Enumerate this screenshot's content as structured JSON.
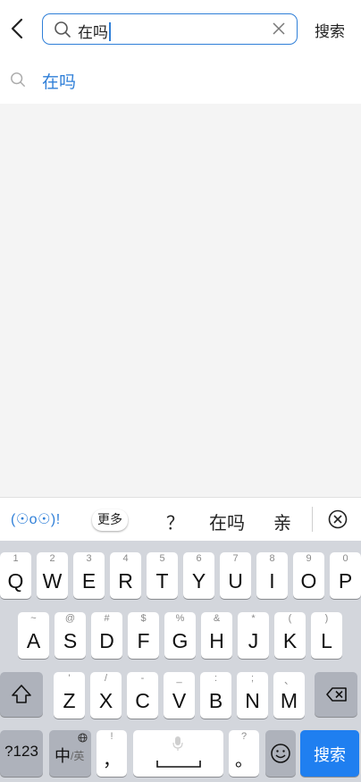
{
  "search": {
    "query": "在吗",
    "submit_label": "搜索"
  },
  "suggestion": {
    "text": "在吗"
  },
  "ime": {
    "emoticon": "(☉o☉)!",
    "more_label": "更多",
    "candidates": [
      "？",
      "在吗",
      "亲"
    ],
    "colors": {
      "accent": "#2f7fd8",
      "enter_key": "#1f7ff0"
    }
  },
  "keyboard": {
    "row1": [
      {
        "key": "Q",
        "hint": "1"
      },
      {
        "key": "W",
        "hint": "2"
      },
      {
        "key": "E",
        "hint": "3"
      },
      {
        "key": "R",
        "hint": "4"
      },
      {
        "key": "T",
        "hint": "5"
      },
      {
        "key": "Y",
        "hint": "6"
      },
      {
        "key": "U",
        "hint": "7"
      },
      {
        "key": "I",
        "hint": "8"
      },
      {
        "key": "O",
        "hint": "9"
      },
      {
        "key": "P",
        "hint": "0"
      }
    ],
    "row2": [
      {
        "key": "A",
        "hint": "~"
      },
      {
        "key": "S",
        "hint": "@"
      },
      {
        "key": "D",
        "hint": "#"
      },
      {
        "key": "F",
        "hint": "$"
      },
      {
        "key": "G",
        "hint": "%"
      },
      {
        "key": "H",
        "hint": "&"
      },
      {
        "key": "J",
        "hint": "*"
      },
      {
        "key": "K",
        "hint": "("
      },
      {
        "key": "L",
        "hint": ")"
      }
    ],
    "row3": [
      {
        "key": "Z",
        "hint": "'"
      },
      {
        "key": "X",
        "hint": "/"
      },
      {
        "key": "C",
        "hint": "-"
      },
      {
        "key": "V",
        "hint": "_"
      },
      {
        "key": "B",
        "hint": ":"
      },
      {
        "key": "N",
        "hint": ";"
      },
      {
        "key": "M",
        "hint": "、"
      }
    ],
    "numbers_label": "?123",
    "lang_main": "中",
    "lang_sub": "/英",
    "comma": "，",
    "comma_hint": "!",
    "period": "。",
    "period_hint": "?",
    "enter_label": "搜索"
  }
}
